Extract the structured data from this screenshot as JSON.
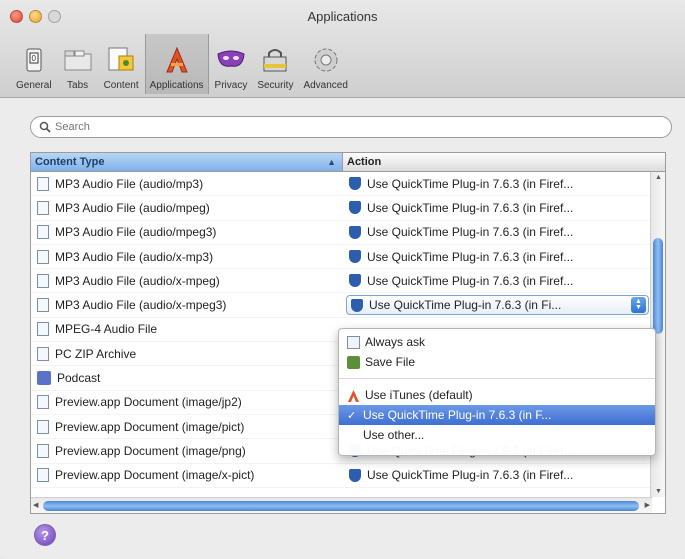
{
  "window": {
    "title": "Applications"
  },
  "toolbar": {
    "items": [
      {
        "label": "General",
        "icon": "switch-icon"
      },
      {
        "label": "Tabs",
        "icon": "tabs-icon"
      },
      {
        "label": "Content",
        "icon": "content-icon"
      },
      {
        "label": "Applications",
        "icon": "applications-icon",
        "selected": true
      },
      {
        "label": "Privacy",
        "icon": "privacy-mask-icon"
      },
      {
        "label": "Security",
        "icon": "security-lock-icon"
      },
      {
        "label": "Advanced",
        "icon": "gear-icon"
      }
    ]
  },
  "search": {
    "placeholder": "Search"
  },
  "table": {
    "headers": {
      "content_type": "Content Type",
      "action": "Action"
    },
    "rows": [
      {
        "type": "MP3 Audio File (audio/mp3)",
        "action": "Use QuickTime Plug-in 7.6.3 (in Firef..."
      },
      {
        "type": "MP3 Audio File (audio/mpeg)",
        "action": "Use QuickTime Plug-in 7.6.3 (in Firef..."
      },
      {
        "type": "MP3 Audio File (audio/mpeg3)",
        "action": "Use QuickTime Plug-in 7.6.3 (in Firef..."
      },
      {
        "type": "MP3 Audio File (audio/x-mp3)",
        "action": "Use QuickTime Plug-in 7.6.3 (in Firef..."
      },
      {
        "type": "MP3 Audio File (audio/x-mpeg)",
        "action": "Use QuickTime Plug-in 7.6.3 (in Firef..."
      },
      {
        "type": "MP3 Audio File (audio/x-mpeg3)",
        "action": "Use QuickTime Plug-in 7.6.3 (in Fi...",
        "popup": true
      },
      {
        "type": "MPEG-4 Audio File",
        "action": ""
      },
      {
        "type": "PC ZIP Archive",
        "action": ""
      },
      {
        "type": "Podcast",
        "action": "",
        "podcast": true
      },
      {
        "type": "Preview.app Document (image/jp2)",
        "action": ""
      },
      {
        "type": "Preview.app Document (image/pict)",
        "action": ""
      },
      {
        "type": "Preview.app Document (image/png)",
        "action": "Use QuickTime Plug-in 7.6.3 (in Firef..."
      },
      {
        "type": "Preview.app Document (image/x-pict)",
        "action": "Use QuickTime Plug-in 7.6.3 (in Firef..."
      }
    ]
  },
  "menu": {
    "always_ask": "Always ask",
    "save_file": "Save File",
    "use_itunes": "Use iTunes (default)",
    "use_quicktime": "Use QuickTime Plug-in 7.6.3 (in F...",
    "use_other": "Use other..."
  },
  "help": {
    "label": "?"
  }
}
